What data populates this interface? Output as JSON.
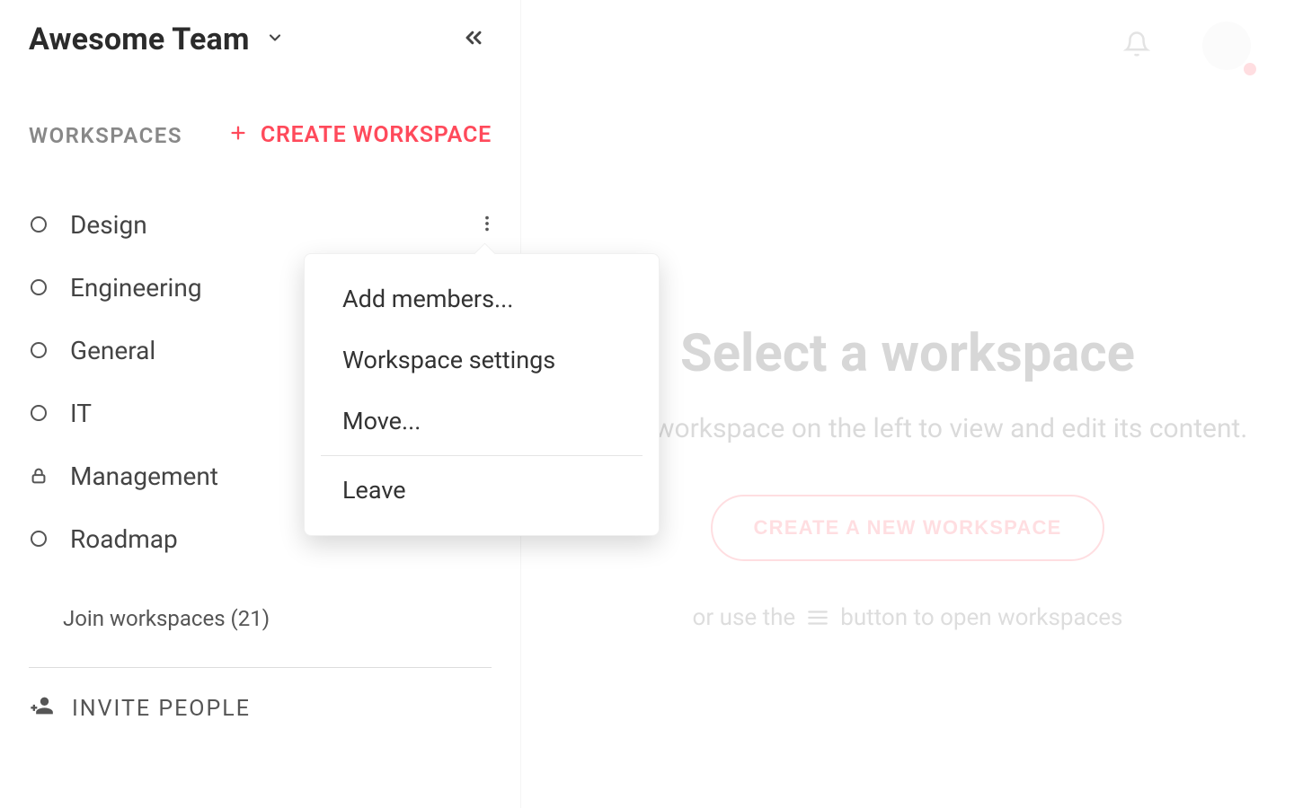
{
  "sidebar": {
    "team_name": "Awesome Team",
    "workspaces_label": "WORKSPACES",
    "create_workspace_label": "CREATE WORKSPACE",
    "items": [
      {
        "name": "Design",
        "locked": false
      },
      {
        "name": "Engineering",
        "locked": false
      },
      {
        "name": "General",
        "locked": false
      },
      {
        "name": "IT",
        "locked": false
      },
      {
        "name": "Management",
        "locked": true
      },
      {
        "name": "Roadmap",
        "locked": false
      }
    ],
    "join_link": "Join workspaces (21)",
    "invite_label": "INVITE PEOPLE"
  },
  "context_menu": {
    "add_members": "Add members...",
    "workspace_settings": "Workspace settings",
    "move": "Move...",
    "leave": "Leave"
  },
  "main": {
    "title": "Select a workspace",
    "subtitle": "Click a workspace on the left to view and edit its content.",
    "create_button": "CREATE A NEW WORKSPACE",
    "hint_prefix": "or use the",
    "hint_suffix": "button to open workspaces"
  },
  "colors": {
    "accent": "#ff4a5b"
  }
}
